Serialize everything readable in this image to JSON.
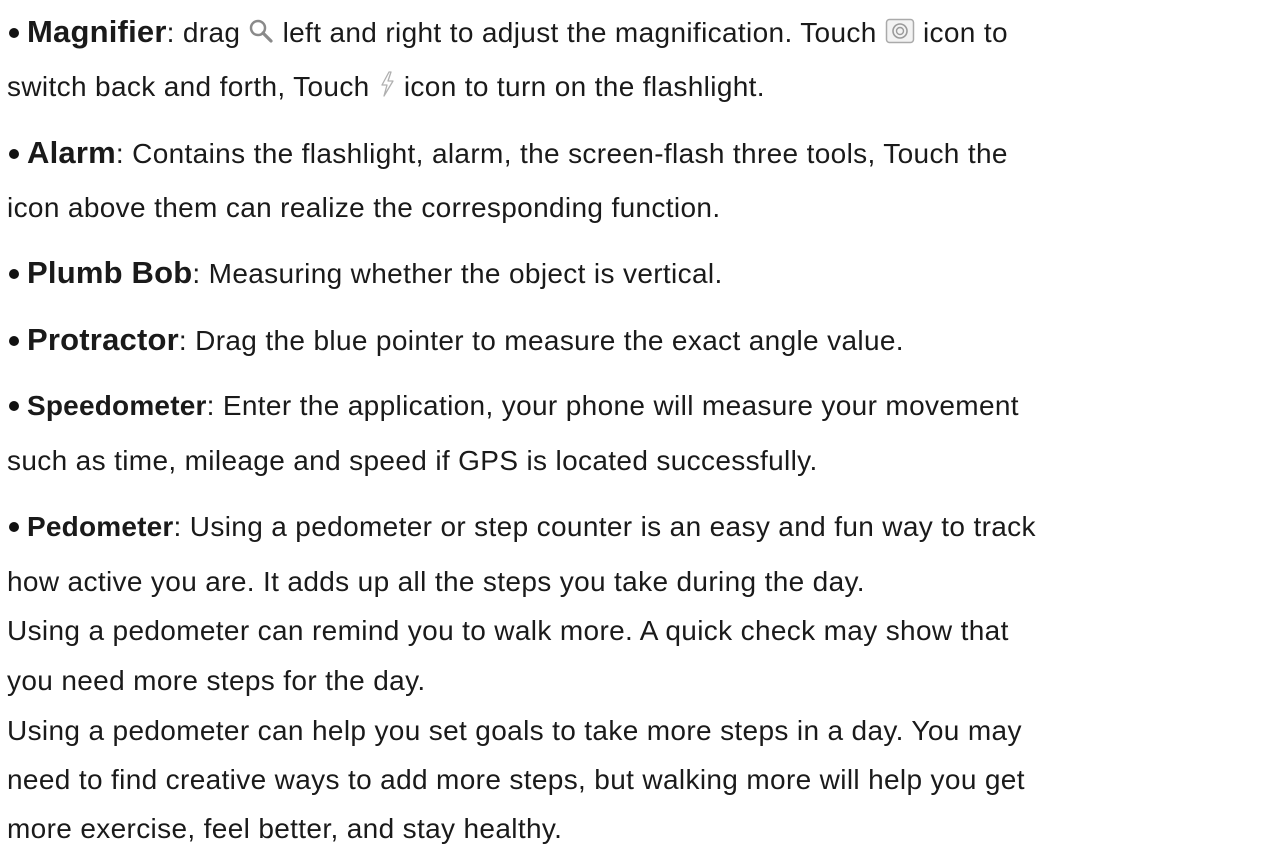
{
  "items": {
    "magnifier": {
      "term": "Magnifier",
      "p1": ": drag ",
      "p2": " left and right to adjust the magnification. Touch ",
      "p3": " icon to",
      "p4": "switch back and forth, Touch ",
      "p5": " icon to turn on the flashlight."
    },
    "alarm": {
      "term": "Alarm",
      "p1": ": Contains the flashlight, alarm, the screen-flash three tools, Touch the",
      "p2": "icon above them can realize the corresponding function."
    },
    "plumb_bob": {
      "term": "Plumb Bob",
      "p1": ": Measuring whether the object is vertical."
    },
    "protractor": {
      "term": "Protractor",
      "p1": ": Drag the blue pointer to measure the exact angle value."
    },
    "speedometer": {
      "term": "Speedometer",
      "p1": ": Enter the application, your phone will measure your movement",
      "p2": "such as time, mileage and speed if GPS is located successfully."
    },
    "pedometer": {
      "term": "Pedometer",
      "p1": ": Using a pedometer or step counter is an easy and fun way to track",
      "p2": "how active you are. It adds up all the steps you take during the day.",
      "p3": "Using a pedometer can remind you to walk more. A quick check may show that",
      "p4": "you need more steps for the day.",
      "p5": "Using a pedometer can help you set goals to take more steps in a day. You may",
      "p6": "need to find creative ways to add more steps, but walking more will help you get",
      "p7": "more exercise, feel better, and stay healthy."
    }
  },
  "icons": {
    "magnify": "magnifier-icon",
    "camera": "camera-switch-icon",
    "flash": "flashlight-icon"
  }
}
